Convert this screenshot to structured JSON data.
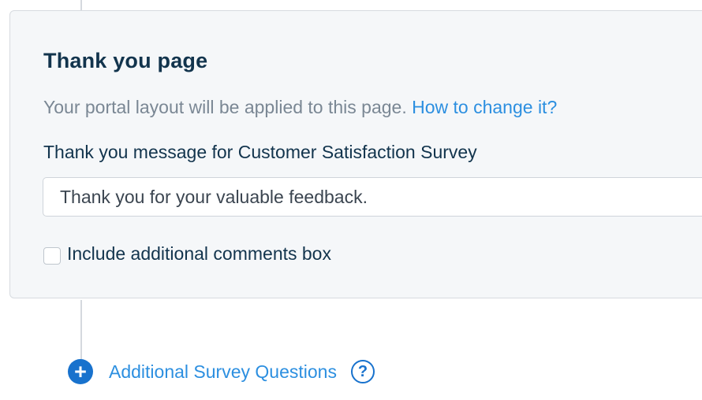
{
  "card": {
    "title": "Thank you page",
    "hint_text": "Your portal layout will be applied to this page. ",
    "hint_link": "How to change it?",
    "message_label": "Thank you message for Customer Satisfaction Survey",
    "message_value": "Thank you for your valuable feedback.",
    "comments_checkbox_label": "Include additional comments box",
    "comments_checkbox_checked": false
  },
  "footer": {
    "add_questions_label": "Additional Survey Questions",
    "add_icon": "plus-icon",
    "help_icon": "question-icon",
    "add_icon_glyph": "+",
    "help_icon_glyph": "?"
  },
  "colors": {
    "accent": "#2c8fe0",
    "icon_blue": "#1872cd",
    "heading": "#12344d",
    "muted": "#7a8794",
    "card_bg": "#f5f7f9"
  }
}
